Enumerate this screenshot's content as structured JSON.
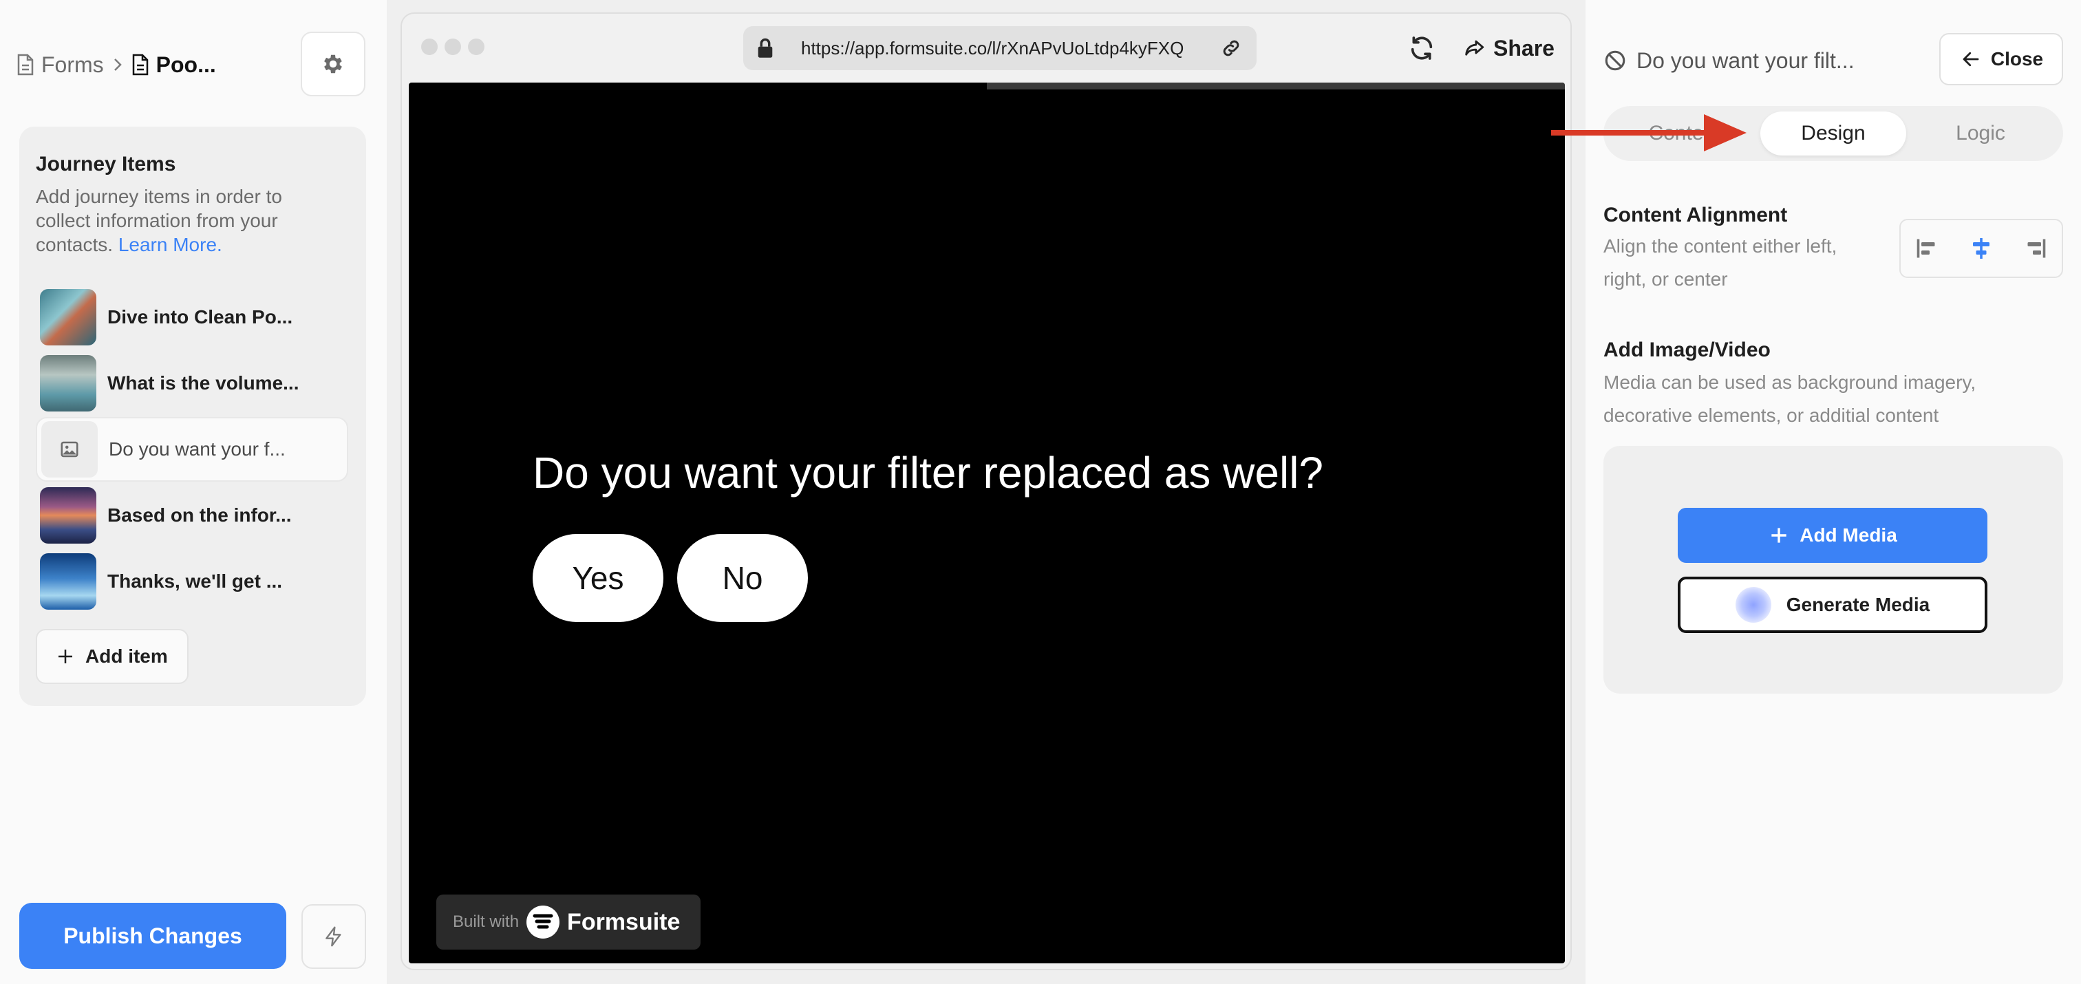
{
  "breadcrumb": {
    "root": "Forms",
    "current": "Poo..."
  },
  "journey": {
    "title": "Journey Items",
    "description": "Add journey items in order to collect information from your contacts.",
    "learn_more": "Learn More.",
    "items": [
      {
        "label": "Dive into Clean Po..."
      },
      {
        "label": "What is the volume..."
      },
      {
        "label": "Do you want your f..."
      },
      {
        "label": "Based on the infor..."
      },
      {
        "label": "Thanks, we'll get ..."
      }
    ],
    "add_item": "Add item"
  },
  "actions": {
    "publish": "Publish Changes"
  },
  "browser": {
    "url": "https://app.formsuite.co/l/rXnAPvUoLtdp4kyFXQ",
    "share": "Share"
  },
  "preview": {
    "question": "Do you want your filter replaced as well?",
    "answers": [
      "Yes",
      "No"
    ],
    "built_with": "Built with",
    "brand": "Formsuite"
  },
  "panel": {
    "title": "Do you want your filt...",
    "close": "Close",
    "tabs": [
      "Content",
      "Design",
      "Logic"
    ],
    "alignment": {
      "heading": "Content Alignment",
      "line1": "Align the content either left,",
      "line2": "right, or center",
      "selected": "center"
    },
    "media": {
      "heading": "Add Image/Video",
      "line1": "Media can be used as background imagery,",
      "line2": "decorative elements, or additial content",
      "add": "Add Media",
      "generate": "Generate Media"
    }
  },
  "colors": {
    "accent": "#3b82f6",
    "annotation_arrow": "#d93a26",
    "stage": "#000000"
  }
}
